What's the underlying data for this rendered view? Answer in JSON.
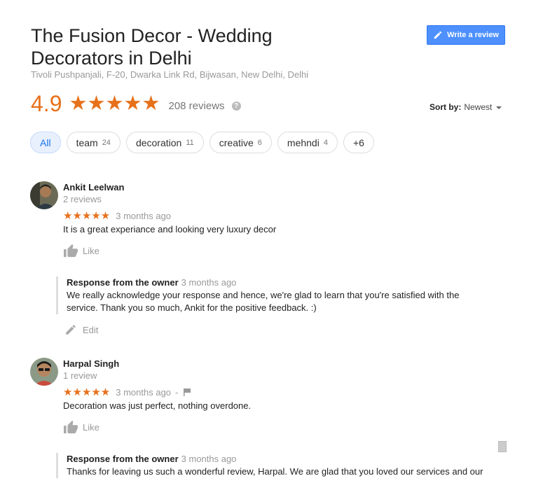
{
  "business": {
    "name": "The Fusion Decor - Wedding Decorators in Delhi",
    "address": "Tivoli Pushpanjali, F-20, Dwarka Link Rd, Bijwasan, New Delhi, Delhi",
    "rating": "4.9",
    "stars": "★★★★★",
    "review_count": "208 reviews",
    "help_glyph": "?"
  },
  "write_review_label": "Write a review",
  "sort": {
    "label": "Sort by:",
    "value": "Newest"
  },
  "chips": [
    {
      "label": "All",
      "count": ""
    },
    {
      "label": "team",
      "count": "24"
    },
    {
      "label": "decoration",
      "count": "11"
    },
    {
      "label": "creative",
      "count": "6"
    },
    {
      "label": "mehndi",
      "count": "4"
    },
    {
      "label": "+6",
      "count": ""
    }
  ],
  "reviews": [
    {
      "name": "Ankit Leelwan",
      "sub": "2 reviews",
      "stars": "★★★★★",
      "time": "3 months ago",
      "text": "It is a great experiance and looking very luxury decor",
      "like_label": "Like",
      "response": {
        "title": "Response from the owner",
        "time": "3 months ago",
        "text": "We really acknowledge your response and hence, we're glad to learn that you're satisfied with the service. Thank you so much, Ankit for the positive feedback. :)"
      },
      "edit_label": "Edit"
    },
    {
      "name": "Harpal Singh",
      "sub": "1 review",
      "stars": "★★★★★",
      "time": "3 months ago",
      "separator": "-",
      "text": "Decoration was just perfect, nothing overdone.",
      "like_label": "Like",
      "response": {
        "title": "Response from the owner",
        "time": "3 months ago",
        "text": "Thanks for leaving us such a wonderful review, Harpal. We are glad that you loved our services and our"
      }
    }
  ],
  "colors": {
    "accent": "#e7711b",
    "button": "#4d90fe"
  }
}
